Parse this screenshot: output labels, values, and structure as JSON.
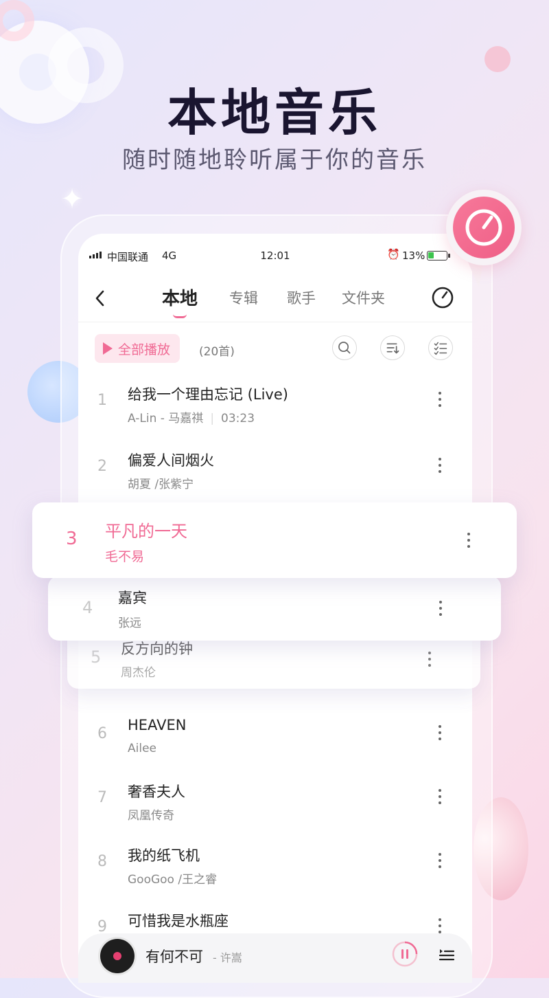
{
  "hero": {
    "title": "本地音乐",
    "subtitle": "随时随地聆听属于你的音乐"
  },
  "status_bar": {
    "carrier": "中国联通",
    "network": "4G",
    "time": "12:01",
    "battery_percent": "13%",
    "battery_level": 0.13
  },
  "tabs": [
    {
      "label": "本地",
      "active": true
    },
    {
      "label": "专辑",
      "active": false
    },
    {
      "label": "歌手",
      "active": false
    },
    {
      "label": "文件夹",
      "active": false
    }
  ],
  "toolbar": {
    "play_all_label": "全部播放",
    "count": "(20首)"
  },
  "songs": [
    {
      "num": "1",
      "title": "给我一个理由忘记 (Live)",
      "artist": "A-Lin - 马嘉祺",
      "duration": "03:23"
    },
    {
      "num": "2",
      "title": "偏爱人间烟火",
      "artist": "胡夏 /张紫宁"
    },
    {
      "num": "3",
      "title": "平凡的一天",
      "artist": "毛不易",
      "playing": true
    },
    {
      "num": "4",
      "title": "嘉宾",
      "artist": "张远"
    },
    {
      "num": "5",
      "title": "反方向的钟",
      "artist": "周杰伦"
    },
    {
      "num": "6",
      "title": "HEAVEN",
      "artist": "Ailee"
    },
    {
      "num": "7",
      "title": "奢香夫人",
      "artist": "凤凰传奇"
    },
    {
      "num": "8",
      "title": "我的纸飞机",
      "artist": "GooGoo /王之睿"
    },
    {
      "num": "9",
      "title": "可惜我是水瓶座",
      "artist": ""
    }
  ],
  "now_playing": {
    "title": "有何不可",
    "artist": "- 许嵩"
  },
  "colors": {
    "accent": "#f06a94",
    "text": "#222222",
    "muted": "#888888"
  },
  "icons": {
    "back": "chevron-left-icon",
    "timer": "timer-icon",
    "search": "search-icon",
    "sort": "sort-icon",
    "multi_select": "checklist-icon",
    "more": "more-vertical-icon",
    "pause": "pause-icon",
    "queue": "playlist-icon"
  }
}
